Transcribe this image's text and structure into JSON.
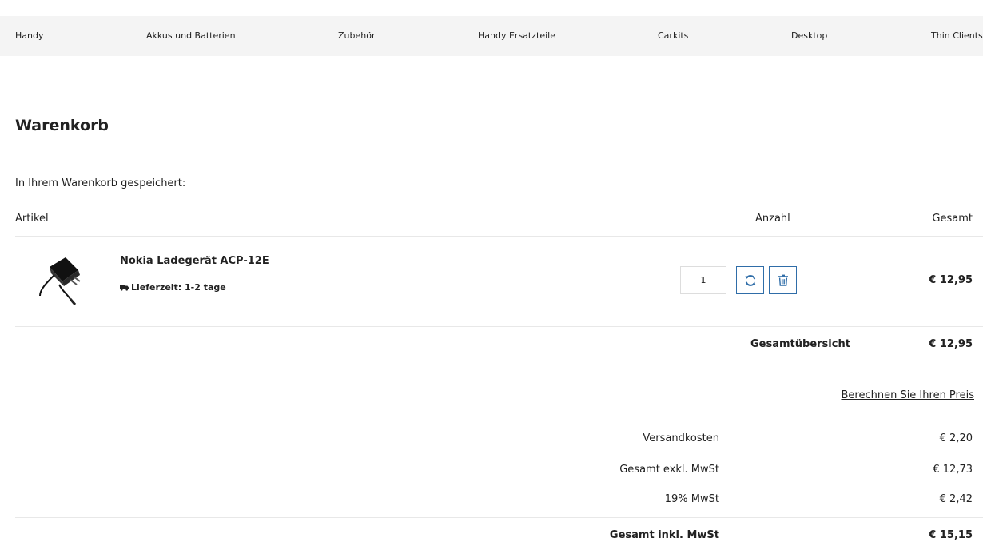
{
  "nav": {
    "items": [
      "Handy",
      "Akkus und Batterien",
      "Zubehör",
      "Handy Ersatzteile",
      "Carkits",
      "Desktop",
      "Thin Clients"
    ]
  },
  "cart": {
    "title": "Warenkorb",
    "saved_text": "In Ihrem Warenkorb gespeichert:",
    "columns": {
      "article": "Artikel",
      "quantity": "Anzahl",
      "total": "Gesamt"
    },
    "item": {
      "name": "Nokia Ladegerät ACP-12E",
      "delivery": "Lieferzeit: 1-2 tage",
      "quantity": "1",
      "price": "€ 12,95",
      "icons": {
        "update": "refresh-icon",
        "delete": "trash-icon",
        "delivery": "truck-icon"
      }
    },
    "overview": {
      "label": "Gesamtübersicht",
      "value": "€ 12,95"
    },
    "calc_link": "Berechnen Sie Ihren Preis",
    "totals": [
      {
        "label": "Versandkosten",
        "value": "€ 2,20"
      },
      {
        "label": "Gesamt exkl. MwSt",
        "value": "€ 12,73"
      },
      {
        "label": "19% MwSt",
        "value": "€ 2,42"
      }
    ],
    "grand_total": {
      "label": "Gesamt inkl. MwSt",
      "value": "€ 15,15"
    }
  },
  "colors": {
    "accent": "#2f6da8",
    "nav_bg": "#f4f4f4"
  }
}
